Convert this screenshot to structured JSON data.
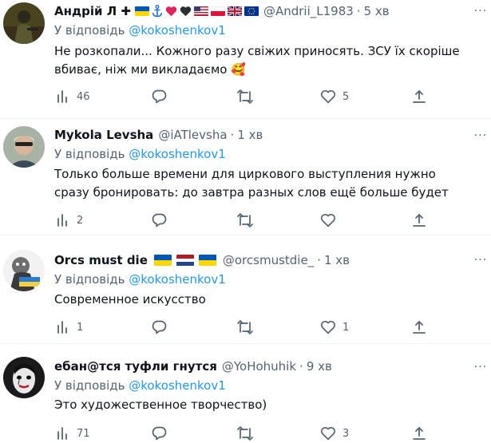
{
  "tweets": [
    {
      "name": "Андрій Л ✚",
      "handle": "@Andrii_L1983",
      "time": "5 хв",
      "reply_prefix": "У відповідь",
      "reply_to": "@kokoshenkov1",
      "text": "Не розкопали... Кожного разу свіжих приносять. ЗСУ їх скоріше вбиває, ніж ми викладаємо 🥰",
      "views": "46",
      "replies": "",
      "retweets": "",
      "likes": "5"
    },
    {
      "name": "Mykola Levsha",
      "handle": "@iATlevsha",
      "time": "1 хв",
      "reply_prefix": "У відповідь",
      "reply_to": "@kokoshenkov1",
      "text": "Только больше времени для циркового выступления нужно сразу бронировать: до завтра разных слов ещё больше будет",
      "views": "2",
      "replies": "",
      "retweets": "",
      "likes": ""
    },
    {
      "name": "Orcs must die",
      "handle": "@orcsmustdie_",
      "time": "1 хв",
      "reply_prefix": "У відповідь",
      "reply_to": "@kokoshenkov1",
      "text": "Современное искусство",
      "views": "1",
      "replies": "",
      "retweets": "",
      "likes": "1"
    },
    {
      "name": "ебан@тся туфли гнутся",
      "handle": "@YoHohuhik",
      "time": "9 хв",
      "reply_prefix": "У відповідь",
      "reply_to": "@kokoshenkov1",
      "text": "Это художественное творчество)",
      "views": "71",
      "replies": "",
      "retweets": "",
      "likes": "3"
    }
  ],
  "colors": {
    "link": "#1d9bf0",
    "secondary": "#536471",
    "text": "#0f1419",
    "divider": "#eff3f4"
  },
  "icons": {
    "views": "bar-chart-icon",
    "reply": "speech-bubble-icon",
    "retweet": "retweet-icon",
    "like": "heart-icon",
    "share": "share-upload-icon",
    "more": "more-dots-icon"
  }
}
